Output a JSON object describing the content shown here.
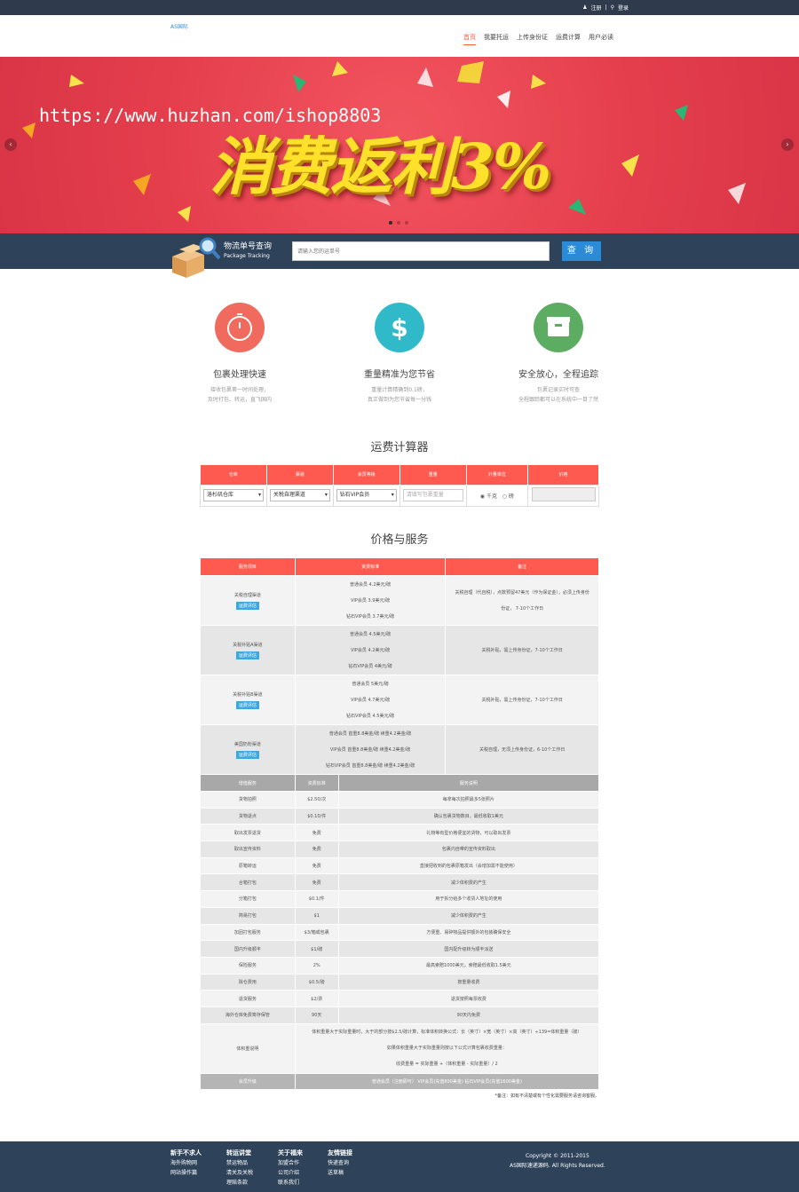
{
  "topbar": {
    "register": "注册",
    "login": "登录",
    "sep": "|"
  },
  "header": {
    "logo": "AS国际",
    "nav": [
      "首页",
      "我要托运",
      "上传身份证",
      "运费计算",
      "用户必读"
    ]
  },
  "banner": {
    "watermark": "https://www.huzhan.com/ishop8803",
    "slogan": "消费返利3%",
    "prev": "‹",
    "next": "›",
    "colors": {
      "bg": "#e8414e",
      "slogan": "#ffe12b"
    }
  },
  "tracker": {
    "title": "物流单号查询",
    "subtitle": "Package Tracking",
    "placeholder": "请输入您的运单号",
    "button": "查 询"
  },
  "features": [
    {
      "title": "包裹处理快速",
      "desc1": "接收包裹第一时间处理，",
      "desc2": "及时打包、转运，直飞国内",
      "color": "#f06a5e",
      "icon": "timer-icon"
    },
    {
      "title": "重量精准为您节省",
      "desc1": "重量计算精确到0.1磅，",
      "desc2": "真正做到为您节省每一分钱",
      "color": "#2fb9c9",
      "icon": "dollar-icon"
    },
    {
      "title": "安全放心，全程追踪",
      "desc1": "包裹记录实时可查",
      "desc2": "全程跟踪都可以在系统中一目了然",
      "color": "#5cac62",
      "icon": "box-icon"
    }
  ],
  "calculator": {
    "title": "运费计算器",
    "headers": [
      "仓库",
      "渠道",
      "会员等级",
      "重量",
      "计量单位",
      "价格"
    ],
    "warehouse": "洛杉矶仓库",
    "channel": "关税自理渠道",
    "member": "钻石VIP会员",
    "weight_placeholder": "请填写包裹重量",
    "unit_a": "千克",
    "unit_b": "磅",
    "unit_radio": "◉",
    "unit_radio_off": "○"
  },
  "service": {
    "title": "价格与服务",
    "headers": [
      "服务项目",
      "资费标准",
      "备注"
    ],
    "badge": "运费评估",
    "rows": [
      {
        "name": "关税自理渠道",
        "prices": [
          "普通会员 4.2美元/磅",
          "VIP会员 3.9美元/磅",
          "钻石VIP会员 3.7美元/磅"
        ],
        "note1": "关税自理（代自税），点数预留47美元（作为保证金），必须上传身份",
        "note2": "份证， 7-10个工作日"
      },
      {
        "name": "关税补贴A渠道",
        "prices": [
          "普通会员 4.5美元/磅",
          "VIP会员 4.2美元/磅",
          "钻石VIP会员 4美元/磅"
        ],
        "note1": "关税补贴，需上传身份证，7-10个工作日",
        "note2": ""
      },
      {
        "name": "关税补贴B渠道",
        "prices": [
          "普通会员 5美元/磅",
          "VIP会员 4.7美元/磅",
          "钻石VIP会员 4.5美元/磅"
        ],
        "note1": "关税补贴，需上传身份证，7-10个工作日",
        "note2": ""
      },
      {
        "name": "美国奶粉渠道",
        "prices": [
          "普通会员 首重8.8美金/磅 续重4.2美金/磅",
          "VIP会员 首重8.8美金/磅 续重4.2美金/磅",
          "钻石VIP会员 首重8.8美金/磅 续重4.2美金/磅"
        ],
        "note1": "关税自理，无须上传身份证，6-10个工作日",
        "note2": ""
      }
    ]
  },
  "extras": {
    "headers": [
      "增值服务",
      "资费标准",
      "服务说明"
    ],
    "rows": [
      [
        "货物拍照",
        "$2.50/次",
        "每拿每次拍照最多5张照片"
      ],
      [
        "货物退点",
        "$0.10/件",
        "确认包裹货物数目，最低收取1美元"
      ],
      [
        "取出发票退货",
        "免费",
        "礼物等有型价格便宜的货物，可以取出发票"
      ],
      [
        "取出宣传资料",
        "免费",
        "包裹内自带的宣传资料取出"
      ],
      [
        "原箱转运",
        "免费",
        "直接把收到的包裹原箱发出（会增加需不能使用）"
      ],
      [
        "合箱打包",
        "免费",
        "减少体积费的产生"
      ],
      [
        "分箱打包",
        "$0.1/件",
        "用于拆分给多个收货人地址的使用"
      ],
      [
        "简易打包",
        "$1",
        "减少体积费的产生"
      ],
      [
        "加固打包服务",
        "$3/箱或包裹",
        "方便重、易碎物品提供额外的包装确保安全"
      ],
      [
        "国内升级顺丰",
        "$1/磅",
        "国内配升级转为顺丰派送"
      ],
      [
        "保险服务",
        "2%",
        "最高索赔1000美元，索赔最低收取1.5美元"
      ],
      [
        "除仓费用",
        "$0.5/磅",
        "按重量收费"
      ],
      [
        "退货服务",
        "$2/票",
        "退货按照每票收费"
      ],
      [
        "海外仓库免费寄存保管",
        "90天",
        "90天内免费"
      ]
    ],
    "volume": {
      "name": "体积重说明",
      "line1": "体积重量大于实际重量时，大于的部分按$2.5/磅计算，标准体积转换公式：长（英寸）×宽（英寸）×高（英寸）÷139=体积重量（磅）",
      "line2": "如果体积重量大于实际重量则按以下公式计算包裹收费重量：",
      "line3": "收费重量 = 实际重量 +（体积重量 - 实际重量）/ 2"
    },
    "upgrade": {
      "name": "会员升级",
      "desc": "普通会员（注册即可）  VIP会员(充值800美金)   钻石VIP会员(充值1600美金)"
    }
  },
  "note": "*备注：如有不清楚或有个性化需要服务请咨询客服。",
  "footer": {
    "cols": [
      {
        "title": "新手不求人",
        "items": [
          "海外购物网",
          "网站操作篇"
        ]
      },
      {
        "title": "转运讲堂",
        "items": [
          "禁运物品",
          "清关及关税",
          "理赔条款"
        ]
      },
      {
        "title": "关于福来",
        "items": [
          "加盟合作",
          "公司介绍",
          "联系我们"
        ]
      },
      {
        "title": "友情链接",
        "items": [
          "快递查询",
          "送草稿"
        ]
      }
    ],
    "copyright": "Copyright © 2011-2015",
    "rights": "AS国际速递源码. All Rights Reserved."
  }
}
